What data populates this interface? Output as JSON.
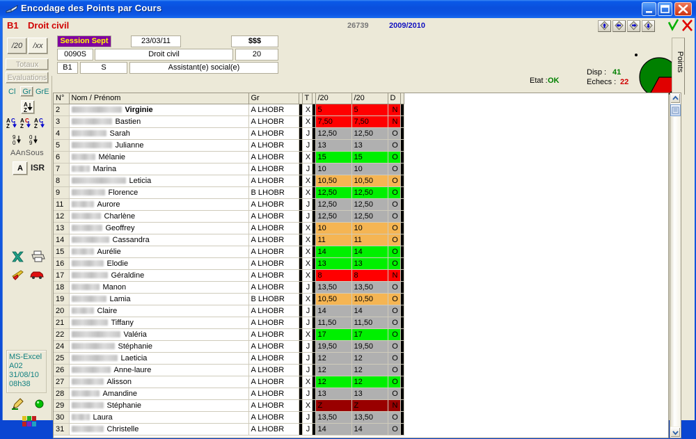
{
  "window": {
    "title": "Encodage des Points par Cours",
    "icon": "book-icon",
    "minimize_label": "Minimiser",
    "maximize_label": "Agrandir",
    "close_label": "Fermer"
  },
  "subheader": {
    "code": "B1",
    "label": "Droit civil",
    "record_number": "26739",
    "academic_year": "2009/2010",
    "nav": {
      "first_label": "Premier",
      "prev_label": "Précédent",
      "next_label": "Suivant",
      "last_label": "Dernier"
    },
    "validate_label": "Valider",
    "cancel_label": "Annuler"
  },
  "sidebar": {
    "scale20_label": "/20",
    "scalexx_label": "/xx",
    "totaux_label": "Totaux",
    "evaluations_label": "Evaluations",
    "cl_label": "Cl",
    "gr_label": "Gr",
    "gre_label": "GrE",
    "sort_az_label": "A-Z",
    "sort_az_c1_label": "A-Z C",
    "sort_az_c2_label": "A-Z C",
    "sort_az_c3_label": "A-Z C",
    "sort_90_label": "9-0",
    "sort_09_label": "0-9",
    "aansous_label": "AAnSous",
    "a_button_label": "A",
    "isr_label": "ISR",
    "excel_icon": "excel-icon",
    "print_icon": "printer-icon",
    "plane_icon": "plane-icon",
    "car_icon": "car-icon",
    "info": {
      "line1": "MS-Excel",
      "line2": "A02",
      "line3": "31/08/10",
      "line4": "08h38"
    },
    "pencil_icon": "pencil-icon",
    "status_icon": "green-led-icon",
    "blocks_icon": "color-blocks-icon"
  },
  "form": {
    "session": "Session Sept",
    "date": "23/03/11",
    "money": "$$$",
    "course_code": "0090S",
    "course_label": "Droit civil",
    "points": "20",
    "year_code": "B1",
    "section_code": "S",
    "section_label": "Assistant(e) social(e)"
  },
  "stats": {
    "etat_label": "Etat :",
    "etat_value": "OK",
    "disp_label": "Disp :",
    "disp_value": "41",
    "echecs_label": "Echecs :",
    "echecs_value": "22",
    "pie_green_color": "#008000",
    "pie_red_color": "#e00000"
  },
  "points_tab_label": "Points",
  "table": {
    "columns": [
      "N°",
      "Nom / Prénom",
      "Gr",
      "",
      "T",
      "",
      "/20",
      "/20",
      "D",
      ""
    ],
    "rows": [
      {
        "n": "2",
        "blur": 72,
        "first": "Virginie",
        "bold": true,
        "gr": "A  LHOBR",
        "t": "X",
        "t_style": "x",
        "m1": "5",
        "m2": "5",
        "d": "N",
        "mark_style": "red"
      },
      {
        "n": "3",
        "blur": 58,
        "first": "Bastien",
        "bold": false,
        "gr": "A  LHOBR",
        "t": "X",
        "t_style": "x",
        "m1": "7,50",
        "m2": "7,50",
        "d": "N",
        "mark_style": "red"
      },
      {
        "n": "4",
        "blur": 50,
        "first": "Sarah",
        "bold": false,
        "gr": "A  LHOBR",
        "t": "J",
        "t_style": "j",
        "m1": "12,50",
        "m2": "12,50",
        "d": "O",
        "mark_style": "grey"
      },
      {
        "n": "5",
        "blur": 58,
        "first": "Julianne",
        "bold": false,
        "gr": "A  LHOBR",
        "t": "J",
        "t_style": "j",
        "m1": "13",
        "m2": "13",
        "d": "O",
        "mark_style": "grey"
      },
      {
        "n": "6",
        "blur": 34,
        "first": "Mélanie",
        "bold": false,
        "gr": "A  LHOBR",
        "t": "X",
        "t_style": "x",
        "m1": "15",
        "m2": "15",
        "d": "O",
        "mark_style": "green"
      },
      {
        "n": "7",
        "blur": 26,
        "first": "Marina",
        "bold": false,
        "gr": "A  LHOBR",
        "t": "J",
        "t_style": "j",
        "m1": "10",
        "m2": "10",
        "d": "O",
        "mark_style": "grey"
      },
      {
        "n": "8",
        "blur": 78,
        "first": "Leticia",
        "bold": false,
        "gr": "A  LHOBR",
        "t": "X",
        "t_style": "x",
        "m1": "10,50",
        "m2": "10,50",
        "d": "O",
        "mark_style": "orange"
      },
      {
        "n": "9",
        "blur": 48,
        "first": "Florence",
        "bold": false,
        "gr": "B  LHOBR",
        "t": "X",
        "t_style": "x",
        "m1": "12,50",
        "m2": "12,50",
        "d": "O",
        "mark_style": "green"
      },
      {
        "n": "11",
        "blur": 32,
        "first": "Aurore",
        "bold": false,
        "gr": "A  LHOBR",
        "t": "J",
        "t_style": "j",
        "m1": "12,50",
        "m2": "12,50",
        "d": "O",
        "mark_style": "grey"
      },
      {
        "n": "12",
        "blur": 42,
        "first": "Charlène",
        "bold": false,
        "gr": "A  LHOBR",
        "t": "J",
        "t_style": "j",
        "m1": "12,50",
        "m2": "12,50",
        "d": "O",
        "mark_style": "grey"
      },
      {
        "n": "13",
        "blur": 44,
        "first": "Geoffrey",
        "bold": false,
        "gr": "A  LHOBR",
        "t": "X",
        "t_style": "x",
        "m1": "10",
        "m2": "10",
        "d": "O",
        "mark_style": "orange"
      },
      {
        "n": "14",
        "blur": 54,
        "first": "Cassandra",
        "bold": false,
        "gr": "A  LHOBR",
        "t": "X",
        "t_style": "x",
        "m1": "11",
        "m2": "11",
        "d": "O",
        "mark_style": "orange"
      },
      {
        "n": "15",
        "blur": 32,
        "first": "Aurélie",
        "bold": false,
        "gr": "A  LHOBR",
        "t": "X",
        "t_style": "x",
        "m1": "14",
        "m2": "14",
        "d": "O",
        "mark_style": "green"
      },
      {
        "n": "16",
        "blur": 46,
        "first": "Elodie",
        "bold": false,
        "gr": "A  LHOBR",
        "t": "X",
        "t_style": "x",
        "m1": "13",
        "m2": "13",
        "d": "O",
        "mark_style": "green"
      },
      {
        "n": "17",
        "blur": 52,
        "first": "Géraldine",
        "bold": false,
        "gr": "A  LHOBR",
        "t": "X",
        "t_style": "x",
        "m1": "8",
        "m2": "8",
        "d": "N",
        "mark_style": "red"
      },
      {
        "n": "18",
        "blur": 40,
        "first": "Manon",
        "bold": false,
        "gr": "A  LHOBR",
        "t": "J",
        "t_style": "j",
        "m1": "13,50",
        "m2": "13,50",
        "d": "O",
        "mark_style": "grey"
      },
      {
        "n": "19",
        "blur": 50,
        "first": "Lamia",
        "bold": false,
        "gr": "B  LHOBR",
        "t": "X",
        "t_style": "x",
        "m1": "10,50",
        "m2": "10,50",
        "d": "O",
        "mark_style": "orange"
      },
      {
        "n": "20",
        "blur": 32,
        "first": "Claire",
        "bold": false,
        "gr": "A  LHOBR",
        "t": "J",
        "t_style": "j",
        "m1": "14",
        "m2": "14",
        "d": "O",
        "mark_style": "grey"
      },
      {
        "n": "21",
        "blur": 52,
        "first": "Tiffany",
        "bold": false,
        "gr": "A  LHOBR",
        "t": "J",
        "t_style": "j",
        "m1": "11,50",
        "m2": "11,50",
        "d": "O",
        "mark_style": "grey"
      },
      {
        "n": "22",
        "blur": 70,
        "first": "Valéria",
        "bold": false,
        "gr": "A  LHOBR",
        "t": "X",
        "t_style": "x",
        "m1": "17",
        "m2": "17",
        "d": "O",
        "mark_style": "green"
      },
      {
        "n": "24",
        "blur": 62,
        "first": "Stéphanie",
        "bold": false,
        "gr": "A  LHOBR",
        "t": "J",
        "t_style": "j",
        "m1": "19,50",
        "m2": "19,50",
        "d": "O",
        "mark_style": "grey"
      },
      {
        "n": "25",
        "blur": 66,
        "first": "Laeticia",
        "bold": false,
        "gr": "A  LHOBR",
        "t": "J",
        "t_style": "j",
        "m1": "12",
        "m2": "12",
        "d": "O",
        "mark_style": "grey"
      },
      {
        "n": "26",
        "blur": 56,
        "first": "Anne-laure",
        "bold": false,
        "gr": "A  LHOBR",
        "t": "J",
        "t_style": "j",
        "m1": "12",
        "m2": "12",
        "d": "O",
        "mark_style": "grey"
      },
      {
        "n": "27",
        "blur": 46,
        "first": "Alisson",
        "bold": false,
        "gr": "A  LHOBR",
        "t": "X",
        "t_style": "x",
        "m1": "12",
        "m2": "12",
        "d": "O",
        "mark_style": "green"
      },
      {
        "n": "28",
        "blur": 40,
        "first": "Amandine",
        "bold": false,
        "gr": "A  LHOBR",
        "t": "J",
        "t_style": "j",
        "m1": "13",
        "m2": "13",
        "d": "O",
        "mark_style": "grey"
      },
      {
        "n": "29",
        "blur": 46,
        "first": "Stéphanie",
        "bold": false,
        "gr": "A  LHOBR",
        "t": "X",
        "t_style": "x",
        "m1": "Z",
        "m2": "Z",
        "d": "N",
        "mark_style": "darkred"
      },
      {
        "n": "30",
        "blur": 26,
        "first": "Laura",
        "bold": false,
        "gr": "A  LHOBR",
        "t": "J",
        "t_style": "j",
        "m1": "13,50",
        "m2": "13,50",
        "d": "O",
        "mark_style": "grey"
      },
      {
        "n": "31",
        "blur": 46,
        "first": "Christelle",
        "bold": false,
        "gr": "A  LHOBR",
        "t": "J",
        "t_style": "j",
        "m1": "14",
        "m2": "14",
        "d": "O",
        "mark_style": "grey"
      }
    ]
  },
  "scrollbar": {
    "up_label": "Défiler vers le haut",
    "down_label": "Défiler vers le bas"
  }
}
